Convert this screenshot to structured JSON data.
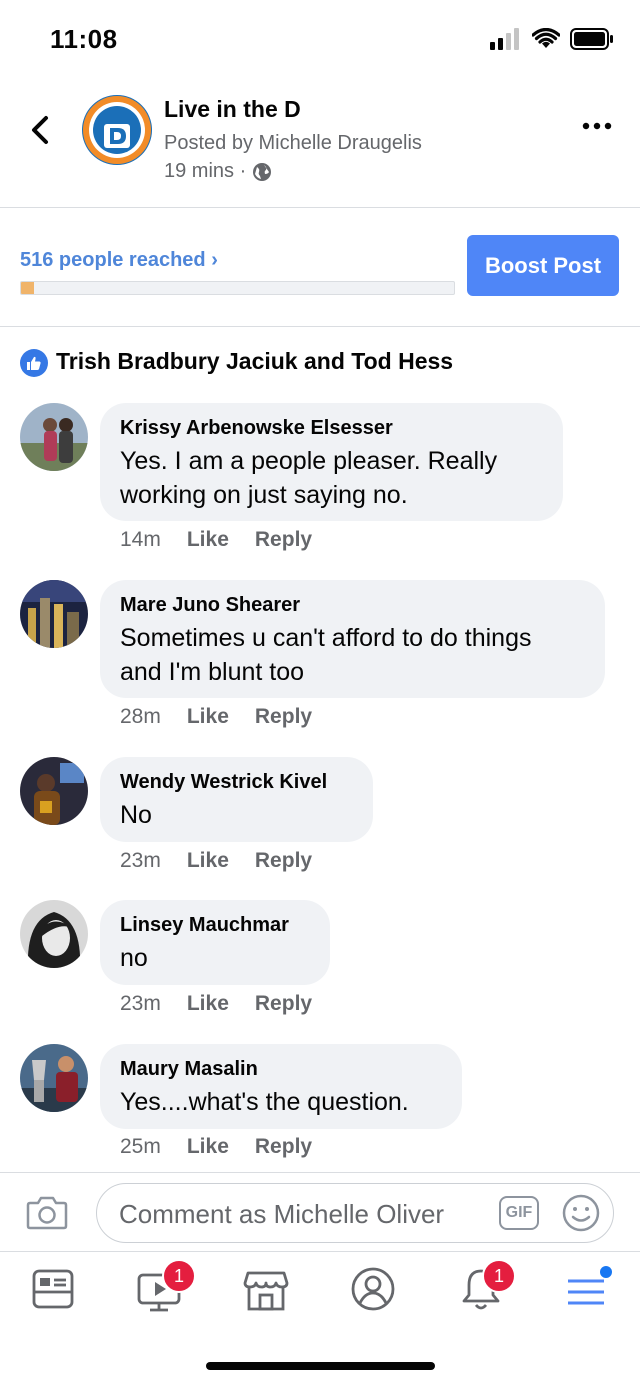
{
  "status_bar": {
    "time": "11:08"
  },
  "header": {
    "page_name": "Live in the D",
    "posted_by": "Posted by Michelle Draugelis",
    "time": "19 mins ·",
    "logo_text_top": "LIVE",
    "logo_text_sub": "IN THE",
    "logo_letter": "D"
  },
  "reach": {
    "text": "516 people reached ›",
    "progress_fraction": 0.03
  },
  "boost_button": "Boost Post",
  "likes": {
    "names": "Trish Bradbury Jaciuk and Tod Hess"
  },
  "comments": [
    {
      "name": "Krissy Arbenowske Elsesser",
      "lines": [
        "Yes.  I am a people pleaser.  Really",
        "working on just saying no."
      ],
      "time": "14m",
      "like": "Like",
      "reply": "Reply"
    },
    {
      "name": "Mare Juno Shearer",
      "lines": [
        "Sometimes u can't afford to do things",
        "and I'm blunt too"
      ],
      "time": "28m",
      "like": "Like",
      "reply": "Reply"
    },
    {
      "name": "Wendy Westrick Kivel",
      "lines": [
        "No"
      ],
      "time": "23m",
      "like": "Like",
      "reply": "Reply"
    },
    {
      "name": "Linsey Mauchmar",
      "lines": [
        "no"
      ],
      "time": "23m",
      "like": "Like",
      "reply": "Reply"
    },
    {
      "name": "Maury Masalin",
      "lines": [
        "Yes....what's the question."
      ],
      "time": "25m",
      "like": "Like",
      "reply": "Reply"
    }
  ],
  "composer": {
    "placeholder": "Comment as Michelle Oliver",
    "gif_label": "GIF"
  },
  "tab_bar": {
    "tabs": [
      "news-feed",
      "watch",
      "marketplace",
      "profile",
      "notifications",
      "menu"
    ],
    "watch_badge": "1",
    "notifications_badge": "1"
  },
  "colors": {
    "accent": "#4f86f7",
    "reach_fill": "#f0b46a",
    "badge": "#e41e3f"
  }
}
